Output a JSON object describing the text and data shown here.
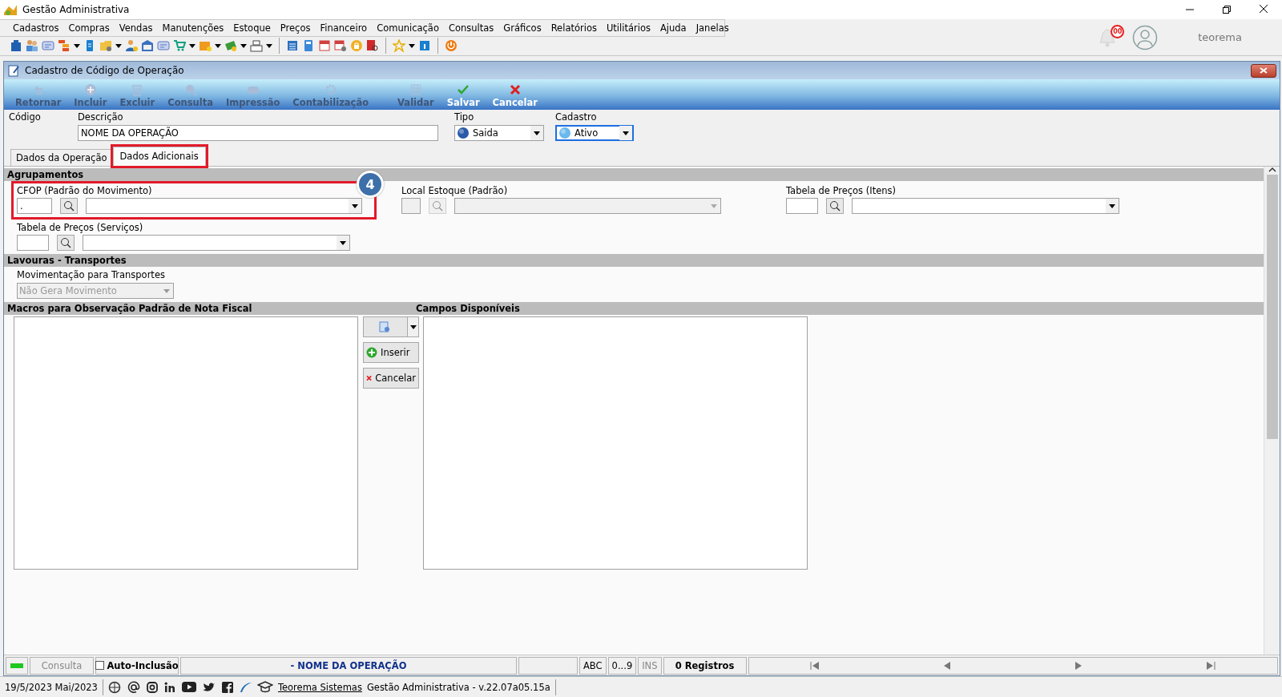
{
  "window": {
    "title": "Gestão Administrativa"
  },
  "menu": [
    "Cadastros",
    "Compras",
    "Vendas",
    "Manutenções",
    "Estoque",
    "Preços",
    "Financeiro",
    "Comunicação",
    "Consultas",
    "Gráficos",
    "Relatórios",
    "Utilitários",
    "Ajuda",
    "Janelas"
  ],
  "header": {
    "notifications": "00",
    "user": "teorema"
  },
  "form_window": {
    "title": "Cadastro de Código de Operação"
  },
  "actions": [
    {
      "label": "Retornar",
      "kind": "back",
      "disabled": true
    },
    {
      "label": "Incluir",
      "kind": "add",
      "disabled": true
    },
    {
      "label": "Excluir",
      "kind": "delete",
      "disabled": true
    },
    {
      "label": "Consulta",
      "kind": "search",
      "disabled": true
    },
    {
      "label": "Impressão",
      "kind": "print",
      "disabled": true
    },
    {
      "label": "Contabilização",
      "kind": "gear",
      "disabled": true
    },
    {
      "label": "Validar",
      "kind": "grid",
      "disabled": true
    },
    {
      "label": "Salvar",
      "kind": "save",
      "disabled": false
    },
    {
      "label": "Cancelar",
      "kind": "cancel",
      "disabled": false
    }
  ],
  "form": {
    "codigo": {
      "label": "Código"
    },
    "descricao": {
      "label": "Descrição",
      "value": "NOME DA OPERAÇÃO"
    },
    "tipo": {
      "label": "Tipo",
      "value": "Saida",
      "focused": false
    },
    "cadastro": {
      "label": "Cadastro",
      "value": "Ativo",
      "focused": true
    }
  },
  "tabs": [
    {
      "label": "Dados da Operação",
      "selected": false,
      "highlighted": false
    },
    {
      "label": "Dados Adicionais",
      "selected": true,
      "highlighted": true
    }
  ],
  "callout": "4",
  "agrupamentos": {
    "title": "Agrupamentos",
    "fields": [
      {
        "label": "CFOP (Padrão do Movimento)",
        "code": ".",
        "disabled": false,
        "highlighted": true
      },
      {
        "label": "Local Estoque (Padrão)",
        "disabled": true,
        "highlighted": false
      },
      {
        "label": "Tabela de Preços (Itens)",
        "disabled": false,
        "highlighted": false
      },
      {
        "label": "Tabela de Preços (Serviços)",
        "disabled": false,
        "highlighted": false
      }
    ]
  },
  "transportes": {
    "title": "Lavouras - Transportes",
    "label": "Movimentação para Transportes",
    "value": "Não Gera Movimento",
    "disabled": true
  },
  "macros": {
    "title": "Macros para Observação Padrão de Nota Fiscal",
    "buttons": [
      {
        "label": "Inserir",
        "kind": "insert"
      },
      {
        "label": "Cancelar",
        "kind": "cancel"
      }
    ]
  },
  "campos": {
    "title": "Campos Disponíveis"
  },
  "status_bar": {
    "mode": "Consulta",
    "auto_inclusao": {
      "label": "Auto-Inclusão",
      "checked": false
    },
    "record": "- NOME DA OPERAÇÃO",
    "abc": "ABC",
    "digits": "0...9",
    "ins": {
      "label": "INS",
      "disabled": true
    },
    "count": "0 Registros"
  },
  "footer": {
    "date": "19/5/2023 Mai/2023",
    "link": "Teorema Sistemas",
    "version": "Gestão Administrativa - v.22.07a05.15a"
  }
}
